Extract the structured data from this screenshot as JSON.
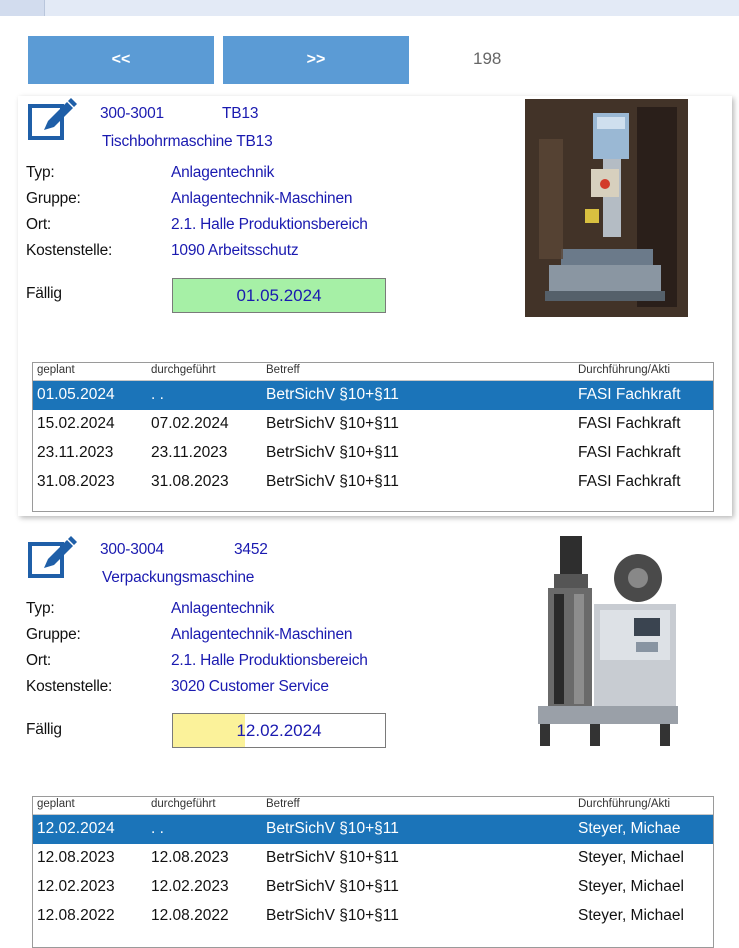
{
  "nav": {
    "prev_label": "<<",
    "next_label": ">>",
    "counter": "198"
  },
  "labels": {
    "typ": "Typ:",
    "gruppe": "Gruppe:",
    "ort": "Ort:",
    "kostenstelle": "Kostenstelle:",
    "faellig": "Fällig"
  },
  "grid_headers": [
    "geplant",
    "durchgeführt",
    "Betreff",
    "Durchführung/Akti"
  ],
  "colors": {
    "selected_row": "#1b74b9",
    "nav_button": "#5b9bd5",
    "due_ok": "#a6f0a6",
    "due_warn": "#fbf29a",
    "link_text": "#1a1ab0"
  },
  "icons": [
    "edit-icon"
  ],
  "items": [
    {
      "number": "300-3001",
      "code": "TB13",
      "name": "Tischbohrmaschine TB13",
      "typ": "Anlagentechnik",
      "gruppe": "Anlagentechnik-Maschinen",
      "ort": "2.1. Halle Produktionsbereich",
      "kostenstelle": "1090 Arbeitsschutz",
      "faellig": "01.05.2024",
      "rows": [
        {
          "geplant": "01.05.2024",
          "durchgefuehrt": ". .",
          "betreff": "BetrSichV §10+§11",
          "durchfuehrung": "FASI Fachkraft",
          "selected": true
        },
        {
          "geplant": "15.02.2024",
          "durchgefuehrt": "07.02.2024",
          "betreff": "BetrSichV §10+§11",
          "durchfuehrung": "FASI Fachkraft"
        },
        {
          "geplant": "23.11.2023",
          "durchgefuehrt": "23.11.2023",
          "betreff": "BetrSichV §10+§11",
          "durchfuehrung": "FASI Fachkraft"
        },
        {
          "geplant": "31.08.2023",
          "durchgefuehrt": "31.08.2023",
          "betreff": "BetrSichV §10+§11",
          "durchfuehrung": "FASI Fachkraft"
        }
      ]
    },
    {
      "number": "300-3004",
      "code": "3452",
      "name": "Verpackungsmaschine",
      "typ": "Anlagentechnik",
      "gruppe": "Anlagentechnik-Maschinen",
      "ort": "2.1. Halle Produktionsbereich",
      "kostenstelle": "3020 Customer Service",
      "faellig": "12.02.2024",
      "rows": [
        {
          "geplant": "12.02.2024",
          "durchgefuehrt": ". .",
          "betreff": "BetrSichV §10+§11",
          "durchfuehrung": "Steyer, Michae",
          "selected": true
        },
        {
          "geplant": "12.08.2023",
          "durchgefuehrt": "12.08.2023",
          "betreff": "BetrSichV §10+§11",
          "durchfuehrung": "Steyer, Michael"
        },
        {
          "geplant": "12.02.2023",
          "durchgefuehrt": "12.02.2023",
          "betreff": "BetrSichV §10+§11",
          "durchfuehrung": "Steyer, Michael"
        },
        {
          "geplant": "12.08.2022",
          "durchgefuehrt": "12.08.2022",
          "betreff": "BetrSichV §10+§11",
          "durchfuehrung": "Steyer, Michael"
        }
      ]
    }
  ]
}
